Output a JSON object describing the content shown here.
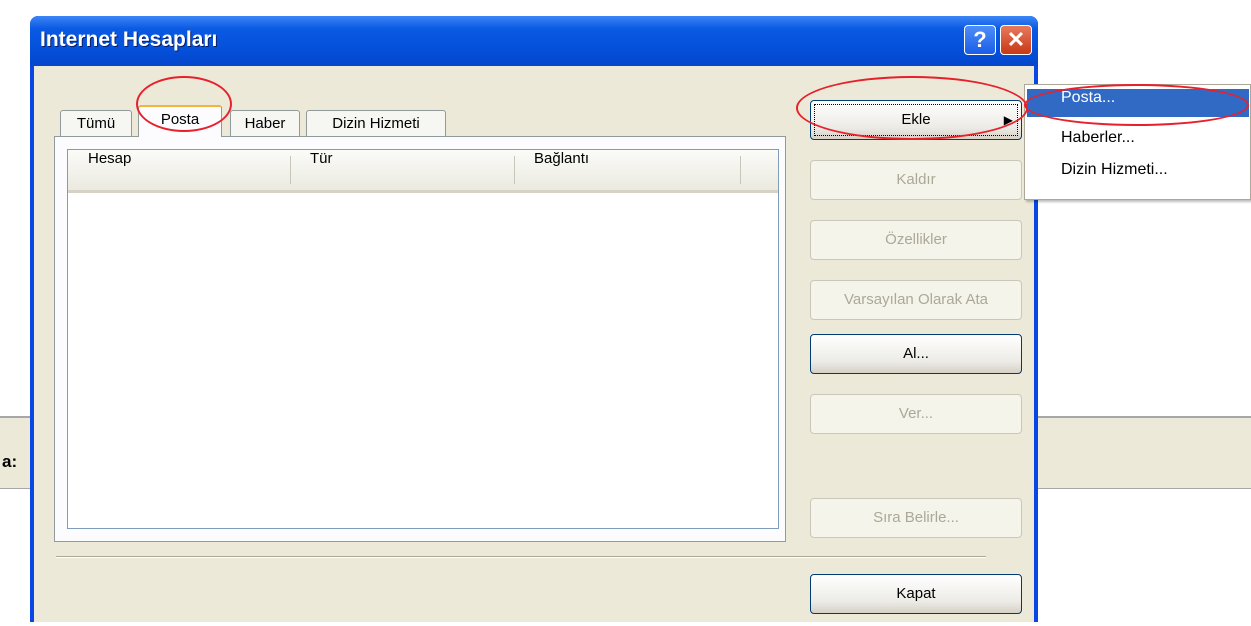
{
  "background": {
    "label_fragment": "a:"
  },
  "dialog": {
    "title": "Internet Hesapları",
    "help_glyph": "?",
    "close_glyph": "✕"
  },
  "tabs": [
    {
      "label": "Tümü",
      "active": false
    },
    {
      "label": "Posta",
      "active": true
    },
    {
      "label": "Haber",
      "active": false
    },
    {
      "label": "Dizin Hizmeti",
      "active": false
    }
  ],
  "list": {
    "columns": [
      "Hesap",
      "Tür",
      "Bağlantı"
    ],
    "rows": []
  },
  "buttons": {
    "add": "Ekle",
    "remove": "Kaldır",
    "properties": "Özellikler",
    "set_default": "Varsayılan Olarak Ata",
    "import": "Al...",
    "export": "Ver...",
    "set_order": "Sıra Belirle...",
    "close": "Kapat"
  },
  "add_menu": {
    "items": [
      "Posta...",
      "Haberler...",
      "Dizin Hizmeti..."
    ],
    "highlighted": "Posta..."
  },
  "colors": {
    "annotation": "#e8202c",
    "highlight": "#316ac5",
    "titlebar": "#0552dc"
  }
}
